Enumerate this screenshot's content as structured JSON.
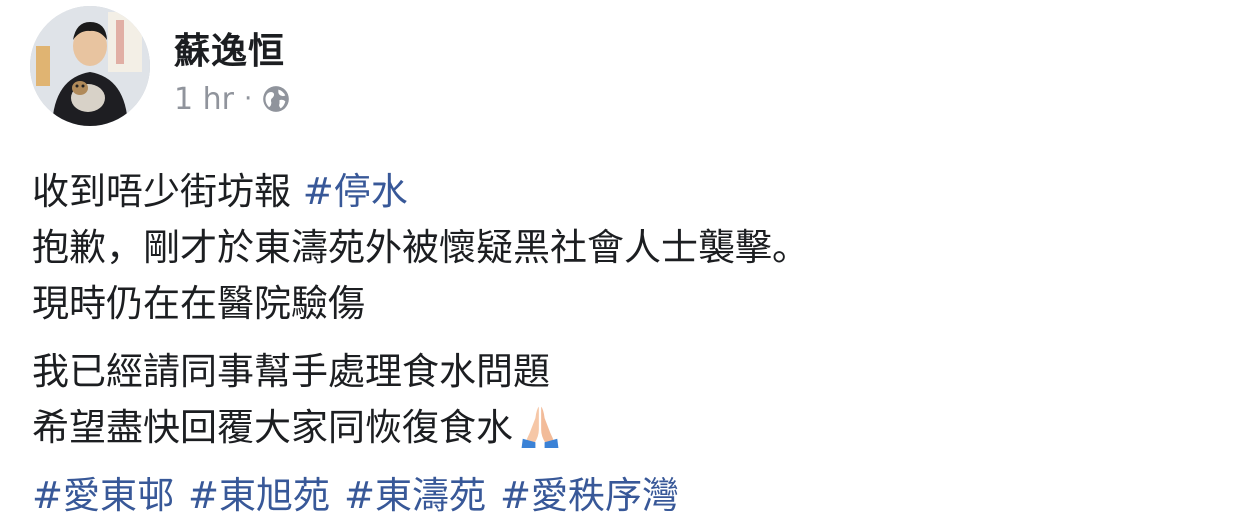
{
  "post": {
    "author": "蘇逸恒",
    "time": "1 hr",
    "separator": "·",
    "privacy_icon": "globe-icon",
    "avatar_icon": "profile-photo"
  },
  "body": {
    "p1": {
      "l1_text": "收到唔少街坊報 ",
      "l1_hashtag": "#停水",
      "l2": "抱歉，剛才於東濤苑外被懷疑黑社會人士襲擊。",
      "l3": "現時仍在在醫院驗傷"
    },
    "p2": {
      "l1": "我已經請同事幫手處理食水問題",
      "l2": "希望盡快回覆大家同恢復食水",
      "emoji": "folded-hands-emoji"
    },
    "hashtags": [
      "#愛東邨",
      "#東旭苑",
      "#東濤苑",
      "#愛秩序灣"
    ]
  },
  "colors": {
    "hashtag": "#385898",
    "meta": "#90949c",
    "text": "#1c1e21"
  }
}
